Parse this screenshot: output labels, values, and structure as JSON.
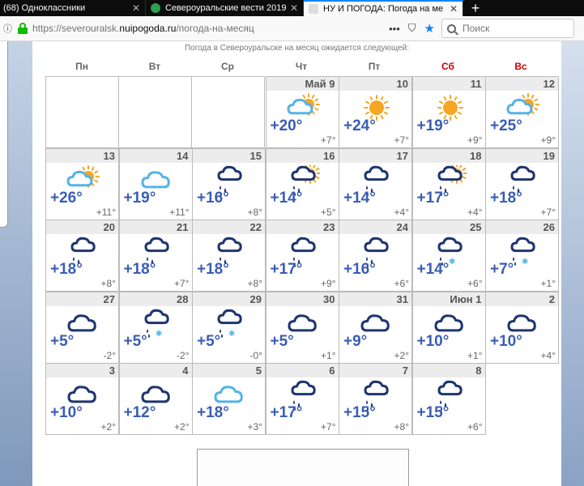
{
  "browser": {
    "tabs": [
      {
        "label": "(68) Одноклассники"
      },
      {
        "label": "Североуральские вести 2019"
      },
      {
        "label": "НУ И ПОГОДА: Погода на ме"
      }
    ],
    "url_prefix": "https://severouralsk.",
    "url_host": "nuipogoda.ru",
    "url_path": "/погода-на-месяц",
    "search_placeholder": "Поиск"
  },
  "page": {
    "intro": "Погода в Североуральске на месяц ожидается следующей:",
    "weekdays": [
      "Пн",
      "Вт",
      "Ср",
      "Чт",
      "Пт",
      "Сб",
      "Вс"
    ],
    "days": [
      {
        "date": "Май 9",
        "icon": "partly-cloudy",
        "day": "+20°",
        "night": "+7°"
      },
      {
        "date": "10",
        "icon": "sun",
        "day": "+24°",
        "night": "+7°"
      },
      {
        "date": "11",
        "icon": "sun",
        "day": "+19°",
        "night": "+9°"
      },
      {
        "date": "12",
        "icon": "partly-cloudy",
        "day": "+25°",
        "night": "+9°"
      },
      {
        "date": "13",
        "icon": "partly-cloudy",
        "day": "+26°",
        "night": "+11°"
      },
      {
        "date": "14",
        "icon": "cloud-light",
        "day": "+19°",
        "night": "+11°"
      },
      {
        "date": "15",
        "icon": "rain",
        "day": "+16°",
        "night": "+8°"
      },
      {
        "date": "16",
        "icon": "rain-sun",
        "day": "+14°",
        "night": "+5°"
      },
      {
        "date": "17",
        "icon": "rain",
        "day": "+14°",
        "night": "+4°"
      },
      {
        "date": "18",
        "icon": "rain-sun",
        "day": "+17°",
        "night": "+4°"
      },
      {
        "date": "19",
        "icon": "rain",
        "day": "+18°",
        "night": "+7°"
      },
      {
        "date": "20",
        "icon": "rain",
        "day": "+18°",
        "night": "+8°"
      },
      {
        "date": "21",
        "icon": "rain",
        "day": "+18°",
        "night": "+7°"
      },
      {
        "date": "22",
        "icon": "rain",
        "day": "+18°",
        "night": "+8°"
      },
      {
        "date": "23",
        "icon": "rain",
        "day": "+17°",
        "night": "+9°"
      },
      {
        "date": "24",
        "icon": "rain",
        "day": "+16°",
        "night": "+6°"
      },
      {
        "date": "25",
        "icon": "rain-snow",
        "day": "+14°",
        "night": "+6°"
      },
      {
        "date": "26",
        "icon": "rain-snow",
        "day": "+7°",
        "night": "+1°"
      },
      {
        "date": "27",
        "icon": "cloud",
        "day": "+5°",
        "night": "-2°"
      },
      {
        "date": "28",
        "icon": "rain-snow",
        "day": "+5°",
        "night": "-2°"
      },
      {
        "date": "29",
        "icon": "rain-snow",
        "day": "+5°",
        "night": "-0°"
      },
      {
        "date": "30",
        "icon": "cloud",
        "day": "+5°",
        "night": "+1°"
      },
      {
        "date": "31",
        "icon": "cloud",
        "day": "+9°",
        "night": "+2°"
      },
      {
        "date": "Июн 1",
        "icon": "cloud",
        "day": "+10°",
        "night": "+1°"
      },
      {
        "date": "2",
        "icon": "cloud",
        "day": "+10°",
        "night": "+4°"
      },
      {
        "date": "3",
        "icon": "cloud",
        "day": "+10°",
        "night": "+2°"
      },
      {
        "date": "4",
        "icon": "cloud",
        "day": "+12°",
        "night": "+2°"
      },
      {
        "date": "5",
        "icon": "cloud-light",
        "day": "+18°",
        "night": "+3°"
      },
      {
        "date": "6",
        "icon": "rain",
        "day": "+17°",
        "night": "+7°"
      },
      {
        "date": "7",
        "icon": "rain",
        "day": "+15°",
        "night": "+8°"
      },
      {
        "date": "8",
        "icon": "rain",
        "day": "+15°",
        "night": "+6°"
      }
    ],
    "colors": {
      "dark_cloud": "#1e3570",
      "light_cloud": "#55b4e6",
      "sun": "#f5a623",
      "temp": "#3a5db4",
      "weekend": "#cc0000"
    }
  }
}
